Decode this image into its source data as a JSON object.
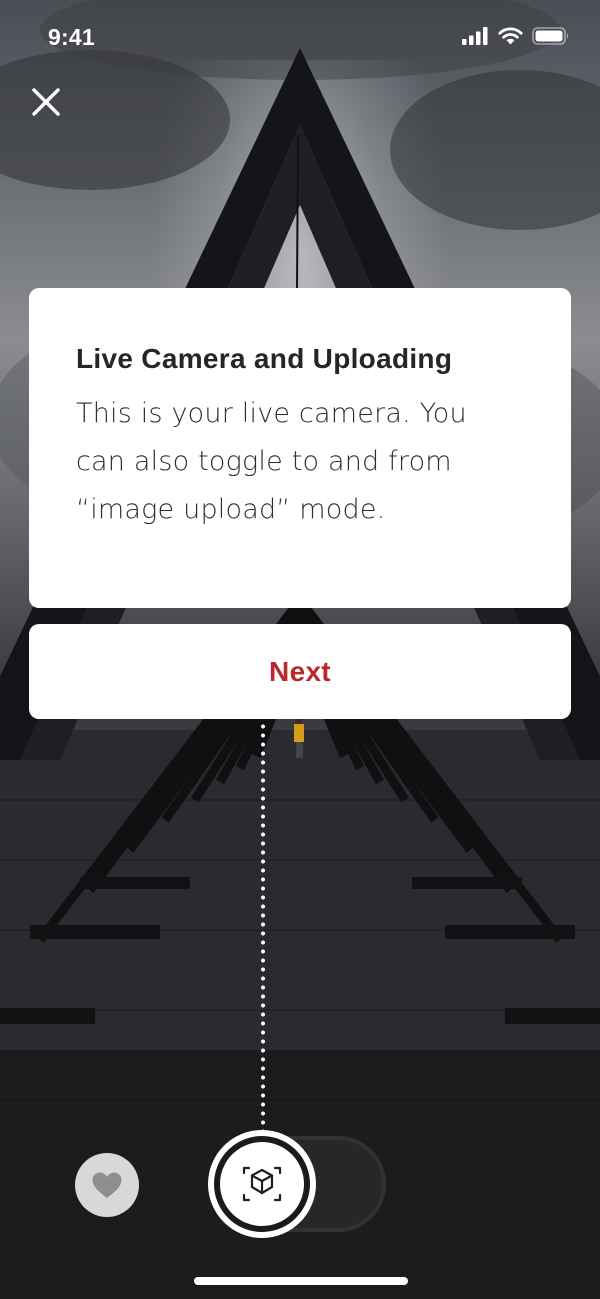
{
  "status_bar": {
    "time": "9:41",
    "icons": [
      "cellular-signal-icon",
      "wifi-icon",
      "battery-icon"
    ]
  },
  "header": {
    "close_icon": "close-icon"
  },
  "coach_card": {
    "title": "Live Camera and Uploading",
    "body": "This is your live camera. You can also toggle to and from “image upload” mode."
  },
  "next_button": {
    "label": "Next",
    "color": "#b8292b"
  },
  "bottom_controls": {
    "favorite_icon": "heart-icon",
    "capture_icon": "ar-cube-icon",
    "mode_toggle": "camera-upload-toggle"
  }
}
